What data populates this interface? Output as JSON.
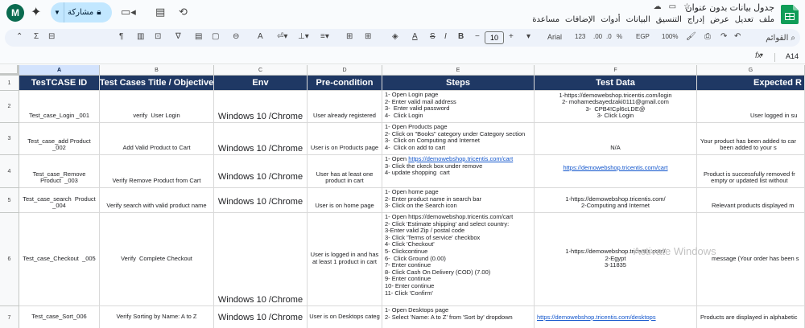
{
  "window": {
    "doc_title": "جدول بيانات بدون عنوان",
    "menu": [
      "ملف",
      "تعديل",
      "عرض",
      "إدراج",
      "التنسيق",
      "البيانات",
      "أدوات",
      "الإضافات",
      "مساعدة"
    ],
    "avatar_letter": "M",
    "share_label": "مشاركة"
  },
  "toolbar": {
    "search_label": "القوائم",
    "zoom": "100%",
    "currency": "EGP",
    "percent": "%",
    "decimals": ".0",
    "decimals_more": ".00",
    "number_format": "123",
    "font": "Arial",
    "font_size": "10",
    "minus": "−",
    "plus": "+"
  },
  "formula_bar": {
    "cell_ref": "A14",
    "fx": "fx"
  },
  "grid": {
    "columns": [
      "A",
      "B",
      "C",
      "D",
      "E",
      "F",
      "G"
    ],
    "row_numbers": [
      "1",
      "2",
      "3",
      "4",
      "5",
      "6",
      "7"
    ],
    "headers": [
      "TesTCASE ID",
      "Test Cases Title / Objective",
      "Env",
      "Pre-condition",
      "Steps",
      "Test Data",
      "Expected R"
    ],
    "rows": [
      {
        "id": "Test_case_Login _001",
        "title": "verify  User Login",
        "env": "Windows 10 /Chrome",
        "pre": "User already registered",
        "steps": "1- Open Login page\n2- Enter valid mail address\n3-  Enter valid password\n4-  Click Login",
        "data": "1-https://demowebshop.tricentis.com/login\n2- mohamedsayedzaki0111@gmail.com\n3-  CPB4!Cpl6cLDE@\n3- Click Login",
        "expected": "User logged in su"
      },
      {
        "id": "Test_case_add Product\n_002",
        "title": "Add Valid Product to Cart",
        "env": "Windows 10 /Chrome",
        "pre": "User is on Products page",
        "steps": "1- Open Products page\n2- Click on \"Books\" category under Category section\n3-  Click on Computing and Internet\n4-  Click on add to cart",
        "data": "N/A",
        "expected": "Your product has been added to car\nbeen added to your s"
      },
      {
        "id": "Test_case_Remove\nProduct  _003",
        "title": "Verify Remove Product from Cart",
        "env": "Windows 10 /Chrome",
        "pre": "User has at least one\nproduct in cart",
        "steps_prefix": "1- Open ",
        "steps_link": "https://demowebshop.tricentis.com/cart",
        "steps_rest": "3- Click the ckeck box under remove\n4- update shopping  cart",
        "data_link": "https://demowebshop.tricentis.com/cart",
        "expected": "Product is successfully removed fr\nempty or updated list without"
      },
      {
        "id": "Test_case_search  Product\n_004",
        "title": "Verify search with valid product name",
        "env": "Windows 10 /Chrome",
        "pre": "User is on home page",
        "steps": "1- Open home page\n2- Enter product name in search bar\n3- Click on the Search icon",
        "data": "1-https://demowebshop.tricentis.com/\n2-Computing and Internet",
        "expected": "Relevant products displayed m"
      },
      {
        "id": "Test_case_Checkout  _005",
        "title": "Verify  Complete Checkout",
        "env": "Windows 10 /Chrome",
        "pre": "User is logged in and has\nat least 1 product in cart",
        "steps": "1- Open https://demowebshop.tricentis.com/cart\n2- Click 'Estimate shipping' and select country:\n3-Enter valid Zip / postal code\n3- Click 'Terms of service' checkbox\n4- Click 'Checkout'\n5- Clickcontinue\n6-  Click Ground (0.00)\n7- Enter continue\n8- Click Cash On Delivery (COD) (7.00)\n9- Enter continue\n10- Enter continue\n11- Click 'Confirm'",
        "data": "1-https://demowebshop.tricentis.com/\n2-Egypt\n3-11835",
        "expected": "message (Your order has been s"
      },
      {
        "id": "Test_case_Sort_006",
        "title": "Verify Sorting by Name: A to Z",
        "env": "Windows 10 /Chrome",
        "pre": "User is on Desktops categ",
        "steps": "1- Open Desktops page\n2- Select 'Name: A to Z' from 'Sort by' dropdown",
        "data_link": "https://demowebshop.tricentis.com/desktops",
        "expected": "Products are displayed in alphabetic"
      }
    ]
  },
  "watermark": "Activate Windows",
  "colors": {
    "header_bg": "#1f3864",
    "share_bg": "#c2e7ff",
    "toolbar_bg": "#edf2fa",
    "sheets_green": "#0f9d58"
  }
}
